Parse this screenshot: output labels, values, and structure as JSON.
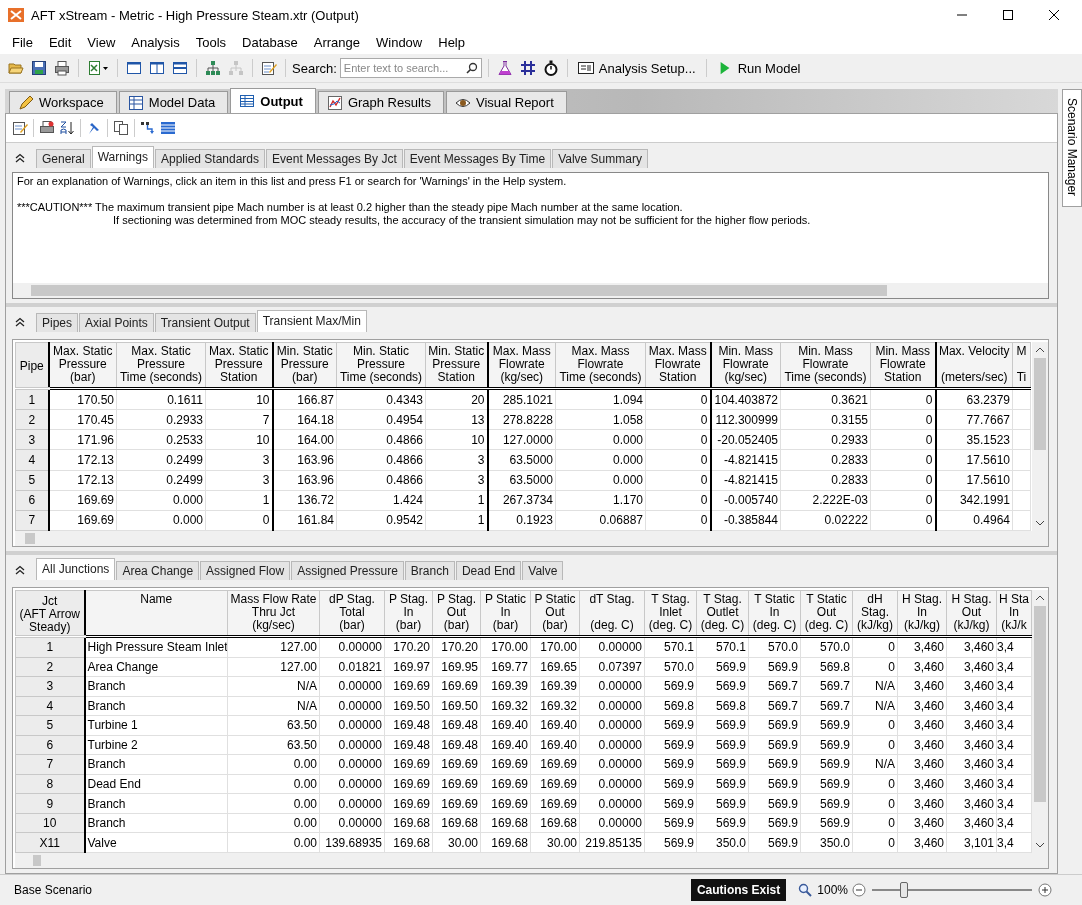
{
  "window": {
    "title": "AFT xStream - Metric - High Pressure Steam.xtr (Output)"
  },
  "menu": [
    "File",
    "Edit",
    "View",
    "Analysis",
    "Tools",
    "Database",
    "Arrange",
    "Window",
    "Help"
  ],
  "toolbar": {
    "search_label": "Search:",
    "search": {
      "placeholder": "Enter text to search..."
    },
    "analysis_button": "Analysis Setup...",
    "run_button": "Run Model"
  },
  "main_tabs": [
    {
      "label": "Workspace",
      "selected": false
    },
    {
      "label": "Model Data",
      "selected": false
    },
    {
      "label": "Output",
      "selected": true
    },
    {
      "label": "Graph Results",
      "selected": false
    },
    {
      "label": "Visual Report",
      "selected": false
    }
  ],
  "side_panel": {
    "label": "Scenario Manager"
  },
  "warnings_section": {
    "tabs": [
      {
        "label": "General",
        "selected": false
      },
      {
        "label": "Warnings",
        "selected": true
      },
      {
        "label": "Applied Standards",
        "selected": false
      },
      {
        "label": "Event Messages By Jct",
        "selected": false
      },
      {
        "label": "Event Messages By Time",
        "selected": false
      },
      {
        "label": "Valve Summary",
        "selected": false
      }
    ],
    "lines": [
      {
        "kind": "intro",
        "text": "For an explanation of Warnings, click an item in this list and press F1 or search for 'Warnings' in the Help system."
      },
      {
        "kind": "caution",
        "text": "***CAUTION*** The maximum transient pipe Mach number is at least 0.2 higher than the steady pipe Mach number at the same location."
      },
      {
        "kind": "continuation",
        "text": "If sectioning was determined from MOC steady results, the accuracy of the transient simulation may not be sufficient for the higher flow periods."
      }
    ]
  },
  "pipe_section": {
    "tabs": [
      {
        "label": "Pipes",
        "selected": false
      },
      {
        "label": "Axial Points",
        "selected": false
      },
      {
        "label": "Transient Output",
        "selected": false
      },
      {
        "label": "Transient Max/Min",
        "selected": true
      }
    ],
    "table": {
      "columns": [
        {
          "label": "Pipe",
          "kind": "row_header",
          "divider": true
        },
        {
          "label": "Max. Static\nPressure\n(bar)",
          "kind": "number",
          "divider": false
        },
        {
          "label": "Max. Static\nPressure\nTime (seconds)",
          "kind": "number",
          "divider": false
        },
        {
          "label": "Max. Static\nPressure\nStation",
          "kind": "number",
          "divider": true
        },
        {
          "label": "Min. Static\nPressure\n(bar)",
          "kind": "number",
          "divider": false
        },
        {
          "label": "Min. Static\nPressure\nTime (seconds)",
          "kind": "number",
          "divider": false
        },
        {
          "label": "Min. Static\nPressure\nStation",
          "kind": "number",
          "divider": true
        },
        {
          "label": "Max. Mass\nFlowrate\n(kg/sec)",
          "kind": "number",
          "divider": false
        },
        {
          "label": "Max. Mass\nFlowrate\nTime (seconds)",
          "kind": "number",
          "divider": false
        },
        {
          "label": "Max. Mass\nFlowrate\nStation",
          "kind": "number",
          "divider": true
        },
        {
          "label": "Min. Mass\nFlowrate\n(kg/sec)",
          "kind": "number",
          "divider": false
        },
        {
          "label": "Min. Mass\nFlowrate\nTime (seconds)",
          "kind": "number",
          "divider": false
        },
        {
          "label": "Min. Mass\nFlowrate\nStation",
          "kind": "number",
          "divider": true
        },
        {
          "label": "Max. Velocity\n\n(meters/sec)",
          "kind": "number",
          "divider": false
        },
        {
          "label": "M\n\nTi",
          "kind": "partial",
          "divider": false
        }
      ],
      "rows": [
        [
          "1",
          "170.50",
          "0.1611",
          "10",
          "166.87",
          "0.4343",
          "20",
          "285.1021",
          "1.094",
          "0",
          "104.403872",
          "0.3621",
          "0",
          "63.2379"
        ],
        [
          "2",
          "170.45",
          "0.2933",
          "7",
          "164.18",
          "0.4954",
          "13",
          "278.8228",
          "1.058",
          "0",
          "112.300999",
          "0.3155",
          "0",
          "77.7667"
        ],
        [
          "3",
          "171.96",
          "0.2533",
          "10",
          "164.00",
          "0.4866",
          "10",
          "127.0000",
          "0.000",
          "0",
          "-20.052405",
          "0.2933",
          "0",
          "35.1523"
        ],
        [
          "4",
          "172.13",
          "0.2499",
          "3",
          "163.96",
          "0.4866",
          "3",
          "63.5000",
          "0.000",
          "0",
          "-4.821415",
          "0.2833",
          "0",
          "17.5610"
        ],
        [
          "5",
          "172.13",
          "0.2499",
          "3",
          "163.96",
          "0.4866",
          "3",
          "63.5000",
          "0.000",
          "0",
          "-4.821415",
          "0.2833",
          "0",
          "17.5610"
        ],
        [
          "6",
          "169.69",
          "0.000",
          "1",
          "136.72",
          "1.424",
          "1",
          "267.3734",
          "1.170",
          "0",
          "-0.005740",
          "2.222E-03",
          "0",
          "342.1991"
        ],
        [
          "7",
          "169.69",
          "0.000",
          "0",
          "161.84",
          "0.9542",
          "1",
          "0.1923",
          "0.06887",
          "0",
          "-0.385844",
          "0.02222",
          "0",
          "0.4964"
        ]
      ]
    }
  },
  "junction_section": {
    "tabs": [
      {
        "label": "All Junctions",
        "selected": true
      },
      {
        "label": "Area Change",
        "selected": false
      },
      {
        "label": "Assigned Flow",
        "selected": false
      },
      {
        "label": "Assigned Pressure",
        "selected": false
      },
      {
        "label": "Branch",
        "selected": false
      },
      {
        "label": "Dead End",
        "selected": false
      },
      {
        "label": "Valve",
        "selected": false
      }
    ],
    "table": {
      "columns": [
        {
          "label": "Jct\n(AFT Arrow\nSteady)",
          "kind": "row_header",
          "divider": true
        },
        {
          "label": "Name",
          "kind": "text",
          "divider": false
        },
        {
          "label": "Mass Flow Rate\nThru Jct\n(kg/sec)",
          "kind": "number",
          "divider": false
        },
        {
          "label": "dP Stag.\nTotal\n(bar)",
          "kind": "number",
          "divider": false
        },
        {
          "label": "P Stag.\nIn\n(bar)",
          "kind": "number",
          "divider": false
        },
        {
          "label": "P Stag.\nOut\n(bar)",
          "kind": "number",
          "divider": false
        },
        {
          "label": "P Static\nIn\n(bar)",
          "kind": "number",
          "divider": false
        },
        {
          "label": "P Static\nOut\n(bar)",
          "kind": "number",
          "divider": false
        },
        {
          "label": "dT Stag.\n\n(deg. C)",
          "kind": "number",
          "divider": false
        },
        {
          "label": "T Stag.\nInlet\n(deg. C)",
          "kind": "number",
          "divider": false
        },
        {
          "label": "T Stag.\nOutlet\n(deg. C)",
          "kind": "number",
          "divider": false
        },
        {
          "label": "T Static\nIn\n(deg. C)",
          "kind": "number",
          "divider": false
        },
        {
          "label": "T Static\nOut\n(deg. C)",
          "kind": "number",
          "divider": false
        },
        {
          "label": "dH\nStag.\n(kJ/kg)",
          "kind": "number",
          "divider": false
        },
        {
          "label": "H Stag.\nIn\n(kJ/kg)",
          "kind": "number",
          "divider": false
        },
        {
          "label": "H Stag.\nOut\n(kJ/kg)",
          "kind": "number",
          "divider": false
        },
        {
          "label": "H Sta\nIn\n(kJ/k",
          "kind": "partial",
          "divider": false
        }
      ],
      "rows": [
        [
          "1",
          "High Pressure Steam Inlet",
          "127.00",
          "0.00000",
          "170.20",
          "170.20",
          "170.00",
          "170.00",
          "0.00000",
          "570.1",
          "570.1",
          "570.0",
          "570.0",
          "0",
          "3,460",
          "3,460",
          "3,4"
        ],
        [
          "2",
          "Area Change",
          "127.00",
          "0.01821",
          "169.97",
          "169.95",
          "169.77",
          "169.65",
          "0.07397",
          "570.0",
          "569.9",
          "569.9",
          "569.8",
          "0",
          "3,460",
          "3,460",
          "3,4"
        ],
        [
          "3",
          "Branch",
          "N/A",
          "0.00000",
          "169.69",
          "169.69",
          "169.39",
          "169.39",
          "0.00000",
          "569.9",
          "569.9",
          "569.7",
          "569.7",
          "N/A",
          "3,460",
          "3,460",
          "3,4"
        ],
        [
          "4",
          "Branch",
          "N/A",
          "0.00000",
          "169.50",
          "169.50",
          "169.32",
          "169.32",
          "0.00000",
          "569.8",
          "569.8",
          "569.7",
          "569.7",
          "N/A",
          "3,460",
          "3,460",
          "3,4"
        ],
        [
          "5",
          "Turbine 1",
          "63.50",
          "0.00000",
          "169.48",
          "169.48",
          "169.40",
          "169.40",
          "0.00000",
          "569.9",
          "569.9",
          "569.9",
          "569.9",
          "0",
          "3,460",
          "3,460",
          "3,4"
        ],
        [
          "6",
          "Turbine 2",
          "63.50",
          "0.00000",
          "169.48",
          "169.48",
          "169.40",
          "169.40",
          "0.00000",
          "569.9",
          "569.9",
          "569.9",
          "569.9",
          "0",
          "3,460",
          "3,460",
          "3,4"
        ],
        [
          "7",
          "Branch",
          "0.00",
          "0.00000",
          "169.69",
          "169.69",
          "169.69",
          "169.69",
          "0.00000",
          "569.9",
          "569.9",
          "569.9",
          "569.9",
          "N/A",
          "3,460",
          "3,460",
          "3,4"
        ],
        [
          "8",
          "Dead End",
          "0.00",
          "0.00000",
          "169.69",
          "169.69",
          "169.69",
          "169.69",
          "0.00000",
          "569.9",
          "569.9",
          "569.9",
          "569.9",
          "0",
          "3,460",
          "3,460",
          "3,4"
        ],
        [
          "9",
          "Branch",
          "0.00",
          "0.00000",
          "169.69",
          "169.69",
          "169.69",
          "169.69",
          "0.00000",
          "569.9",
          "569.9",
          "569.9",
          "569.9",
          "0",
          "3,460",
          "3,460",
          "3,4"
        ],
        [
          "10",
          "Branch",
          "0.00",
          "0.00000",
          "169.68",
          "169.68",
          "169.68",
          "169.68",
          "0.00000",
          "569.9",
          "569.9",
          "569.9",
          "569.9",
          "0",
          "3,460",
          "3,460",
          "3,4"
        ],
        [
          "X11",
          "Valve",
          "0.00",
          "139.68935",
          "169.68",
          "30.00",
          "169.68",
          "30.00",
          "219.85135",
          "569.9",
          "350.0",
          "569.9",
          "350.0",
          "0",
          "3,460",
          "3,101",
          "3,4"
        ]
      ]
    }
  },
  "status_bar": {
    "scenario": "Base Scenario",
    "badge": "Cautions Exist",
    "zoom": "100%",
    "zoom_slider": {
      "level": 0.2
    }
  }
}
